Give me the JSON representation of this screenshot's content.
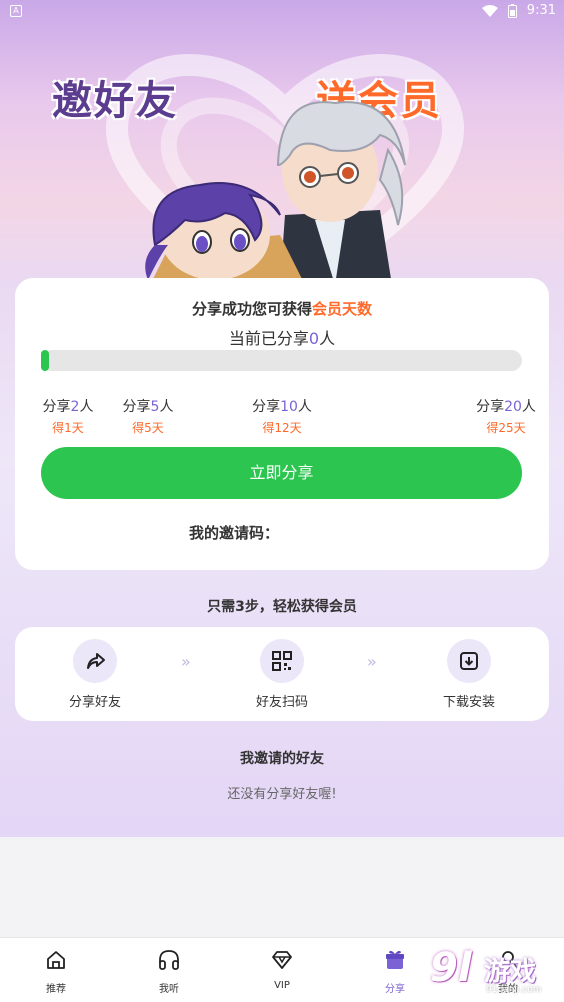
{
  "status_bar": {
    "left_icon": "A",
    "time": "9:31"
  },
  "banner": {
    "left": "邀好友",
    "right": "送会员"
  },
  "main_card": {
    "title_prefix": "分享成功您可获得",
    "title_accent": "会员天数",
    "subtitle_prefix": "当前已分享",
    "subtitle_count": "0",
    "subtitle_suffix": "人",
    "progress_fraction": 0,
    "milestones": [
      {
        "prefix": "分享",
        "count": "2",
        "suffix": "人",
        "reward": "得1天"
      },
      {
        "prefix": "分享",
        "count": "5",
        "suffix": "人",
        "reward": "得5天"
      },
      {
        "prefix": "分享",
        "count": "10",
        "suffix": "人",
        "reward": "得12天"
      },
      {
        "prefix": "分享",
        "count": "20",
        "suffix": "人",
        "reward": "得25天"
      }
    ],
    "share_button": "立即分享",
    "invite_code_label": "我的邀请码："
  },
  "steps": {
    "title": "只需3步，轻松获得会员",
    "items": [
      {
        "label": "分享好友",
        "icon": "share-icon"
      },
      {
        "label": "好友扫码",
        "icon": "qrcode-icon"
      },
      {
        "label": "下载安装",
        "icon": "download-icon"
      }
    ],
    "arrow": "»"
  },
  "friends": {
    "title": "我邀请的好友",
    "empty": "还没有分享好友喔!"
  },
  "tabbar": [
    {
      "label": "推荐",
      "icon": "home-icon"
    },
    {
      "label": "我听",
      "icon": "headphones-icon"
    },
    {
      "label": "VIP",
      "icon": "diamond-icon"
    },
    {
      "label": "分享",
      "icon": "gift-icon",
      "active": true
    },
    {
      "label": "我的",
      "icon": "user-icon"
    }
  ],
  "watermark": {
    "num": "9l",
    "text": "游戏",
    "url": "91danji.com"
  },
  "colors": {
    "accent_green": "#2cc54f",
    "accent_orange": "#ff6a2a",
    "accent_purple": "#7b63d6"
  }
}
